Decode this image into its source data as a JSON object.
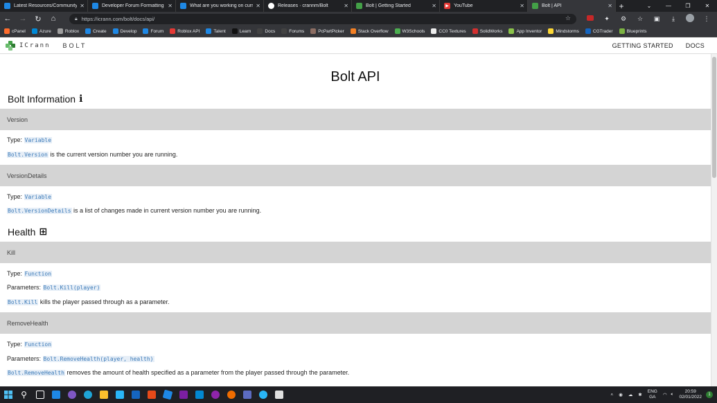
{
  "browser": {
    "tabs": [
      {
        "title": "Latest Resources/Community Re",
        "color": "#1e88e5",
        "active": false
      },
      {
        "title": "Developer Forum Formatting G",
        "color": "#1e88e5",
        "active": false
      },
      {
        "title": "What are you working on curre",
        "color": "#1e88e5",
        "active": false
      },
      {
        "title": "Releases · crannm/Bolt",
        "color": "#ffffff",
        "active": false
      },
      {
        "title": "Bolt | Getting Started",
        "color": "#43a047",
        "active": false
      },
      {
        "title": "YouTube",
        "color": "#e53935",
        "active": false
      },
      {
        "title": "Bolt | API",
        "color": "#43a047",
        "active": true
      }
    ],
    "url": "https://icrann.com/bolt/docs/api/",
    "bookmarks": [
      {
        "label": "cPanel",
        "color": "#ff6c2c"
      },
      {
        "label": "Azure",
        "color": "#0089d6"
      },
      {
        "label": "Roblox",
        "color": "#9e9e9e"
      },
      {
        "label": "Create",
        "color": "#1e88e5"
      },
      {
        "label": "Develop",
        "color": "#1e88e5"
      },
      {
        "label": "Forum",
        "color": "#1e88e5"
      },
      {
        "label": "Roblox API",
        "color": "#e53935"
      },
      {
        "label": "Talent",
        "color": "#1e88e5"
      },
      {
        "label": "Learn",
        "color": "#111111"
      },
      {
        "label": "Docs",
        "color": "#424242"
      },
      {
        "label": "Forums",
        "color": "#424242"
      },
      {
        "label": "PcPartPicker",
        "color": "#8d6e63"
      },
      {
        "label": "Stack Overflow",
        "color": "#f48024"
      },
      {
        "label": "W3Schools",
        "color": "#4caf50"
      },
      {
        "label": "CC0 Textures",
        "color": "#eeeeee"
      },
      {
        "label": "SolidWorks",
        "color": "#d32f2f"
      },
      {
        "label": "App Inventor",
        "color": "#8bc34a"
      },
      {
        "label": "Mindstorms",
        "color": "#fdd835"
      },
      {
        "label": "CGTrader",
        "color": "#1565c0"
      },
      {
        "label": "Blueprints",
        "color": "#7cb342"
      }
    ]
  },
  "site": {
    "brand": "ICrann",
    "product": "BOLT",
    "nav": [
      "GETTING STARTED",
      "DOCS"
    ]
  },
  "page": {
    "title": "Bolt API",
    "sections": {
      "info": {
        "heading": "Bolt Information",
        "version": {
          "name": "Version",
          "type_label": "Type:",
          "type": "Variable",
          "code": "Bolt.Version",
          "desc": "is the current version number you are running."
        },
        "version_details": {
          "name": "VersionDetails",
          "type_label": "Type:",
          "type": "Variable",
          "code": "Bolt.VersionDetails",
          "desc": "is a list of changes made in current version number you are running."
        }
      },
      "health": {
        "heading": "Health",
        "kill": {
          "name": "Kill",
          "type_label": "Type:",
          "type": "Function",
          "params_label": "Parameters:",
          "params": "Bolt.Kill(player)",
          "code": "Bolt.Kill",
          "desc": "kills the player passed through as a parameter."
        },
        "remove_health": {
          "name": "RemoveHealth",
          "type_label": "Type:",
          "type": "Function",
          "params_label": "Parameters:",
          "params": "Bolt.RemoveHealth(player, health)",
          "code": "Bolt.RemoveHealth",
          "desc": "removes the amount of health specified as a parameter from the player passed through the parameter."
        }
      }
    }
  },
  "taskbar": {
    "lang": "ENG",
    "region": "GA",
    "time": "20:59",
    "date": "02/01/2022",
    "notifications": "1"
  }
}
